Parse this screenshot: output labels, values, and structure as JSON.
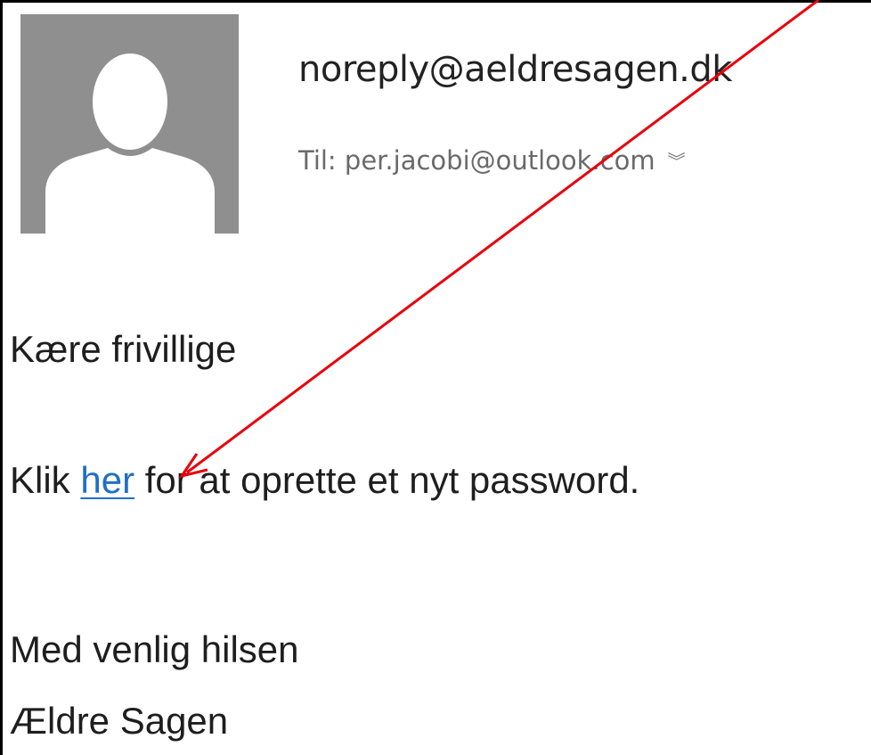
{
  "email": {
    "sender": "noreply@aeldresagen.dk",
    "to_line": "Til: per.jacobi@outlook.com",
    "expand_icon": "double-chevron-down-icon"
  },
  "message": {
    "greeting": "Kære frivillige",
    "instruction_prefix": "Klik ",
    "link_text": "her",
    "instruction_suffix": " for at oprette et nyt password.",
    "closing": "Med venlig hilsen",
    "signature": "Ældre Sagen"
  },
  "colors": {
    "link": "#1f6fc5",
    "annotation_arrow": "#e8000b",
    "avatar_bg": "#8f8f8f"
  }
}
